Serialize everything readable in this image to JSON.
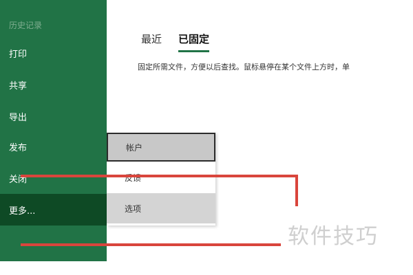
{
  "sidebar": {
    "items": [
      {
        "label": "历史记录"
      },
      {
        "label": "打印"
      },
      {
        "label": "共享"
      },
      {
        "label": "导出"
      },
      {
        "label": "发布"
      },
      {
        "label": "关闭"
      },
      {
        "label": "更多..."
      }
    ]
  },
  "main": {
    "tabs": [
      {
        "label": "最近",
        "selected": false
      },
      {
        "label": "已固定",
        "selected": true
      }
    ],
    "description": "固定所需文件，方便以后查找。鼠标悬停在某个文件上方时，单"
  },
  "more_menu": {
    "items": [
      {
        "label": "帐户"
      },
      {
        "label": "反馈"
      },
      {
        "label": "选项"
      }
    ]
  },
  "watermark": "软件技巧",
  "colors": {
    "sidebar_bg": "#217346",
    "sidebar_active_bg": "#0e4a25",
    "annotation_red": "#d9453c"
  }
}
